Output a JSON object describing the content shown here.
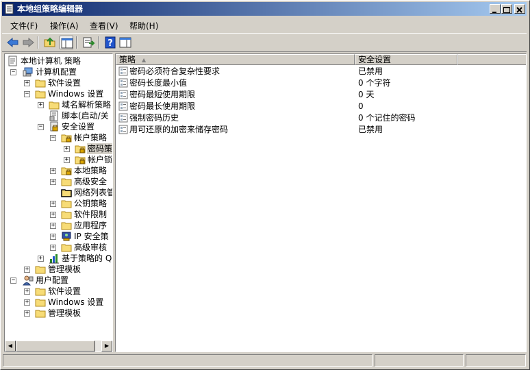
{
  "window": {
    "title": "本地组策略编辑器"
  },
  "menu": [
    "文件(F)",
    "操作(A)",
    "查看(V)",
    "帮助(H)"
  ],
  "tree": [
    {
      "label": "本地计算机 策略",
      "icon": "policy-icon",
      "exp": ""
    },
    {
      "label": "计算机配置",
      "icon": "computer-icon",
      "exp": "-"
    },
    {
      "label": "软件设置",
      "icon": "folder-icon",
      "exp": "+"
    },
    {
      "label": "Windows 设置",
      "icon": "folder-icon",
      "exp": "-"
    },
    {
      "label": "域名解析策略",
      "icon": "folder-icon",
      "exp": "+"
    },
    {
      "label": "脚本(启动/关",
      "icon": "script-icon",
      "exp": ""
    },
    {
      "label": "安全设置",
      "icon": "security-icon",
      "exp": "-"
    },
    {
      "label": "帐户策略",
      "icon": "folder-lock-icon",
      "exp": "-"
    },
    {
      "label": "密码策",
      "icon": "folder-lock-icon",
      "exp": "+"
    },
    {
      "label": "帐户锁",
      "icon": "folder-lock-icon",
      "exp": "+"
    },
    {
      "label": "本地策略",
      "icon": "folder-lock-icon",
      "exp": "+"
    },
    {
      "label": "高级安全",
      "icon": "folder-icon",
      "exp": "+"
    },
    {
      "label": "网络列表管",
      "icon": "folder-dark-icon",
      "exp": ""
    },
    {
      "label": "公钥策略",
      "icon": "folder-icon",
      "exp": "+"
    },
    {
      "label": "软件限制",
      "icon": "folder-icon",
      "exp": "+"
    },
    {
      "label": "应用程序",
      "icon": "folder-icon",
      "exp": "+"
    },
    {
      "label": "IP 安全策",
      "icon": "ipsec-icon",
      "exp": "+"
    },
    {
      "label": "高级审核",
      "icon": "folder-icon",
      "exp": "+"
    },
    {
      "label": "基于策略的 Q",
      "icon": "chart-icon",
      "exp": "+"
    },
    {
      "label": "管理模板",
      "icon": "folder-icon",
      "exp": "+"
    },
    {
      "label": "用户配置",
      "icon": "user-icon",
      "exp": "-"
    },
    {
      "label": "软件设置",
      "icon": "folder-icon",
      "exp": "+"
    },
    {
      "label": "Windows 设置",
      "icon": "folder-icon",
      "exp": "+"
    },
    {
      "label": "管理模板",
      "icon": "folder-icon",
      "exp": "+"
    }
  ],
  "list": {
    "columns": [
      "策略",
      "安全设置"
    ],
    "rows": [
      {
        "name": "密码必须符合复杂性要求",
        "value": "已禁用"
      },
      {
        "name": "密码长度最小值",
        "value": "0 个字符"
      },
      {
        "name": "密码最短使用期限",
        "value": "0 天"
      },
      {
        "name": "密码最长使用期限",
        "value": "0"
      },
      {
        "name": "强制密码历史",
        "value": "0 个记住的密码"
      },
      {
        "name": "用可还原的加密来储存密码",
        "value": "已禁用"
      }
    ]
  },
  "colors": {
    "title_start": "#0a246a",
    "title_end": "#a6caf0",
    "face": "#d4d0c8"
  }
}
